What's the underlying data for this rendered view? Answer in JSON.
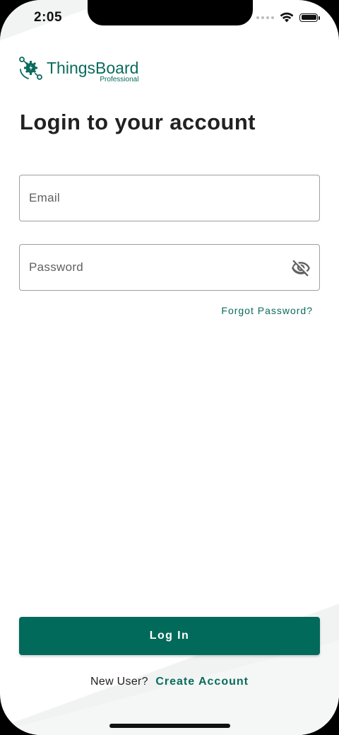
{
  "status_bar": {
    "time": "2:05"
  },
  "brand": {
    "name": "ThingsBoard",
    "edition": "Professional",
    "color": "#0a6b5c"
  },
  "login": {
    "title": "Login to your account",
    "email_placeholder": "Email",
    "email_value": "",
    "password_placeholder": "Password",
    "password_value": "",
    "forgot_password_label": "Forgot Password?",
    "login_button_label": "Log In",
    "button_color": "#026a5b"
  },
  "signup": {
    "question": "New User?",
    "link_label": "Create Account"
  },
  "icons": {
    "password_toggle": "eye-off-icon",
    "wifi": "wifi-icon",
    "battery": "battery-icon",
    "signal": "signal-icon"
  }
}
